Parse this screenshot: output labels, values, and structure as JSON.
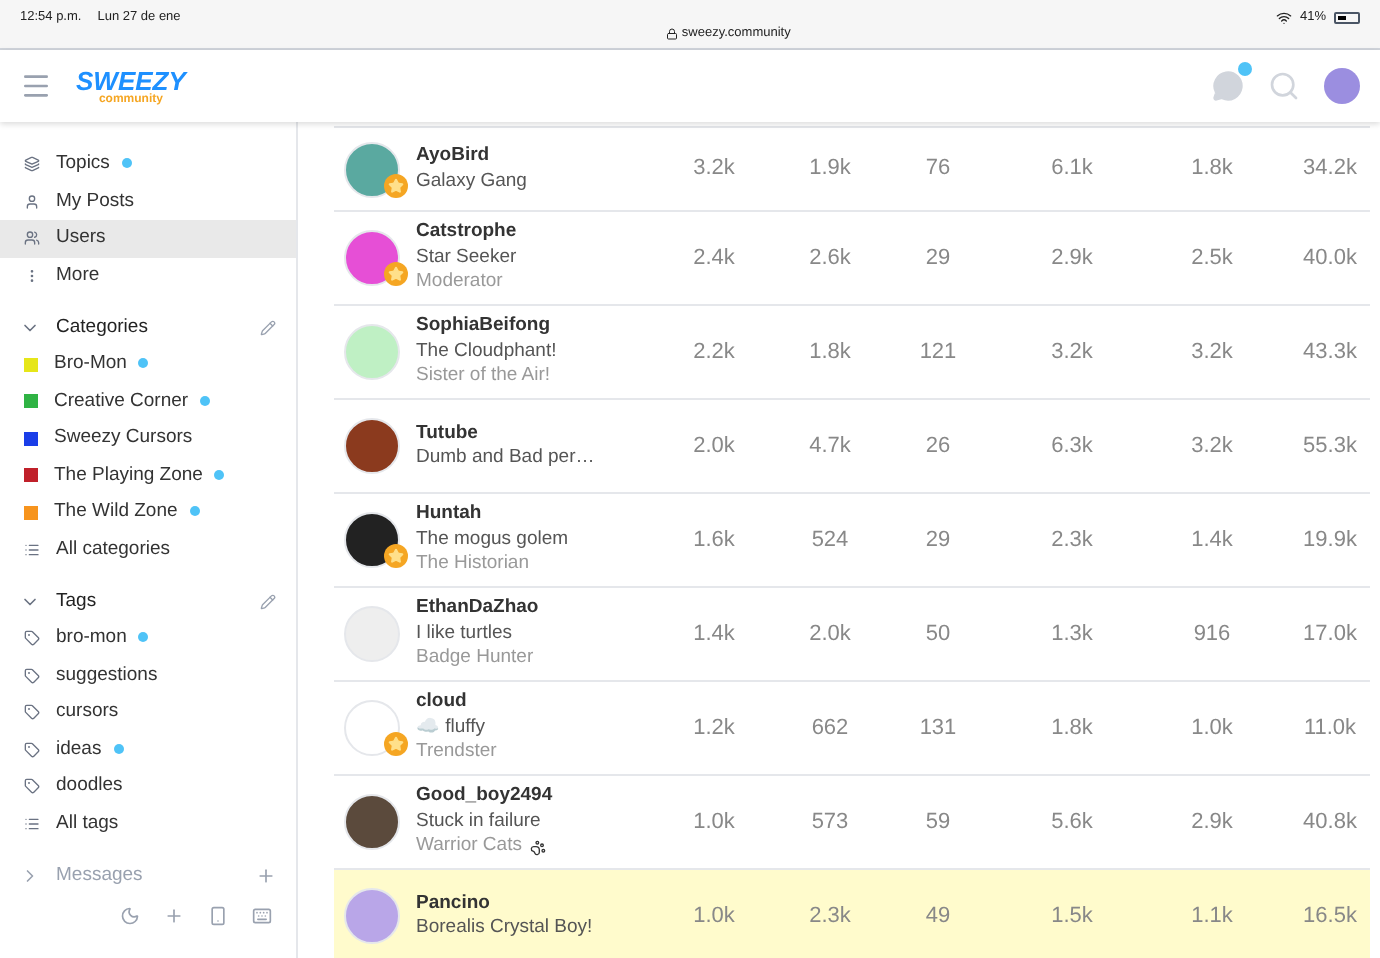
{
  "status_bar": {
    "time": "12:54 p.m.",
    "date": "Lun 27 de ene",
    "url": "sweezy.community",
    "battery": "41%"
  },
  "header": {
    "logo_title": "SWEEZY",
    "logo_subtitle": "community",
    "chat_unread": true
  },
  "sidebar": {
    "items": [
      {
        "label": "Topics",
        "unread": true,
        "selected": false
      },
      {
        "label": "My Posts",
        "unread": false,
        "selected": false
      },
      {
        "label": "Users",
        "unread": false,
        "selected": true
      },
      {
        "label": "More",
        "unread": false,
        "selected": false
      }
    ],
    "categories": {
      "title": "Categories",
      "expanded": true,
      "items": [
        {
          "label": "Bro-Mon",
          "color": "#e6e619",
          "unread": true
        },
        {
          "label": "Creative Corner",
          "color": "#2fb344",
          "unread": true
        },
        {
          "label": "Sweezy Cursors",
          "color": "#1a3ee8",
          "unread": false
        },
        {
          "label": "The Playing Zone",
          "color": "#c0202a",
          "unread": true
        },
        {
          "label": "The Wild Zone",
          "color": "#f7941d",
          "unread": true
        }
      ],
      "all": "All categories"
    },
    "tags": {
      "title": "Tags",
      "expanded": true,
      "items": [
        {
          "label": "bro-mon",
          "unread": true
        },
        {
          "label": "suggestions",
          "unread": false
        },
        {
          "label": "cursors",
          "unread": false
        },
        {
          "label": "ideas",
          "unread": true
        },
        {
          "label": "doodles",
          "unread": false
        }
      ],
      "all": "All tags"
    },
    "messages": {
      "title": "Messages",
      "expanded": false
    }
  },
  "users": [
    {
      "name": "AyoBird",
      "title": "Galaxy Gang",
      "badge": true,
      "highlighted": false,
      "stats": [
        "3.2k",
        "1.9k",
        "76",
        "6.1k",
        "1.8k",
        "34.2k"
      ]
    },
    {
      "name": "Catstrophe",
      "title": "Star Seeker",
      "flair": "Moderator",
      "badge": true,
      "highlighted": false,
      "stats": [
        "2.4k",
        "2.6k",
        "29",
        "2.9k",
        "2.5k",
        "40.0k"
      ]
    },
    {
      "name": "SophiaBeifong",
      "title": "The Cloudphant!",
      "flair": "Sister of the Air!",
      "badge": false,
      "highlighted": false,
      "stats": [
        "2.2k",
        "1.8k",
        "121",
        "3.2k",
        "3.2k",
        "43.3k"
      ]
    },
    {
      "name": "Tutube",
      "title": "Dumb and Bad per…",
      "badge": false,
      "highlighted": false,
      "stats": [
        "2.0k",
        "4.7k",
        "26",
        "6.3k",
        "3.2k",
        "55.3k"
      ]
    },
    {
      "name": "Huntah",
      "title": "The mogus golem",
      "flair": "The Historian",
      "badge": true,
      "highlighted": false,
      "stats": [
        "1.6k",
        "524",
        "29",
        "2.3k",
        "1.4k",
        "19.9k"
      ]
    },
    {
      "name": "EthanDaZhao",
      "title": "I like turtles",
      "flair": "Badge Hunter",
      "badge": false,
      "highlighted": false,
      "stats": [
        "1.4k",
        "2.0k",
        "50",
        "1.3k",
        "916",
        "17.0k"
      ]
    },
    {
      "name": "cloud",
      "title": "☁️ fluffy",
      "flair": "Trendster",
      "badge": true,
      "highlighted": false,
      "stats": [
        "1.2k",
        "662",
        "131",
        "1.8k",
        "1.0k",
        "11.0k"
      ]
    },
    {
      "name": "Good_boy2494",
      "title": "Stuck in failure",
      "flair": "Warrior Cats",
      "badge": false,
      "highlighted": false,
      "stats": [
        "1.0k",
        "573",
        "59",
        "5.6k",
        "2.9k",
        "40.8k"
      ]
    },
    {
      "name": "Pancino",
      "title": "Borealis Crystal Boy!",
      "badge": false,
      "highlighted": true,
      "stats": [
        "1.0k",
        "2.3k",
        "49",
        "1.5k",
        "1.1k",
        "16.5k"
      ]
    }
  ]
}
